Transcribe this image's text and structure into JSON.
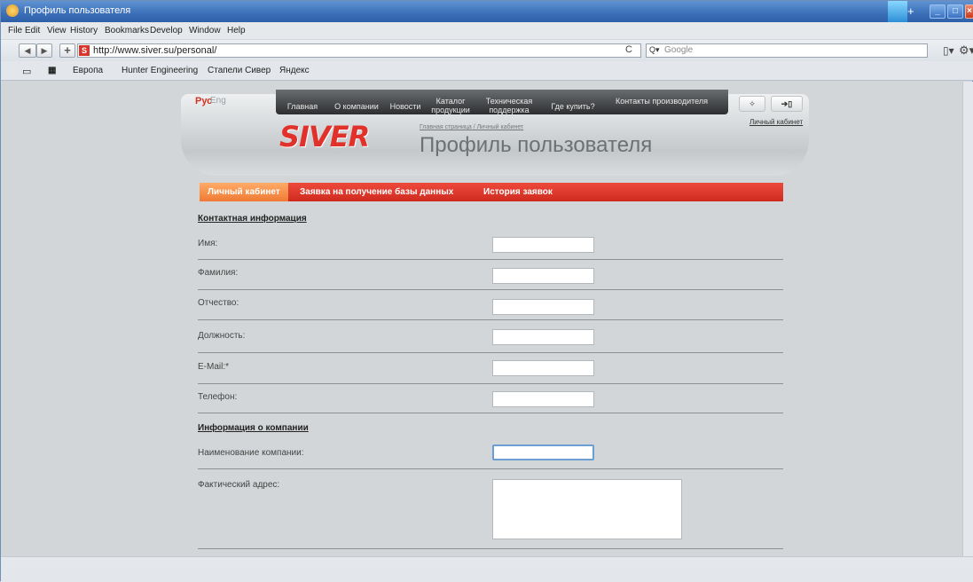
{
  "window": {
    "title": "Профиль пользователя"
  },
  "menu": [
    "File",
    "Edit",
    "View",
    "History",
    "Bookmarks",
    "Develop",
    "Window",
    "Help"
  ],
  "address": {
    "url": "http://www.siver.su/personal/",
    "search_placeholder": "Google",
    "favicon_letter": "S"
  },
  "bookmarks": [
    "Европа",
    "Hunter Engineering",
    "Стапели Сивер",
    "Яндекс"
  ],
  "site": {
    "lang_ru": "Рус",
    "lang_en": "Eng",
    "nav": [
      "Главная",
      "О компании",
      "Новости",
      "Каталог продукции",
      "Техническая поддержка",
      "Где купить?",
      "Контакты производителя"
    ],
    "account_link": "Личный кабинет",
    "logo": "SIVER",
    "breadcrumb": "Главная страница / Личный кабинет",
    "page_title": "Профиль пользователя"
  },
  "tabs": [
    "Личный кабинет",
    "Заявка на получение базы данных",
    "История заявок"
  ],
  "form": {
    "section_contact": "Контактная информация",
    "fields": [
      "Имя:",
      "Фамилия:",
      "Отчество:",
      "Должность:",
      "E-Mail:*",
      "Телефон:"
    ],
    "section_company": "Информация о компании",
    "company_fields": [
      "Наименование компании:",
      "Фактический адрес:"
    ]
  },
  "colors": {
    "accent_red": "#e0312b",
    "active_tab": "#f07a34",
    "titlebar": "#3b6fb8"
  }
}
